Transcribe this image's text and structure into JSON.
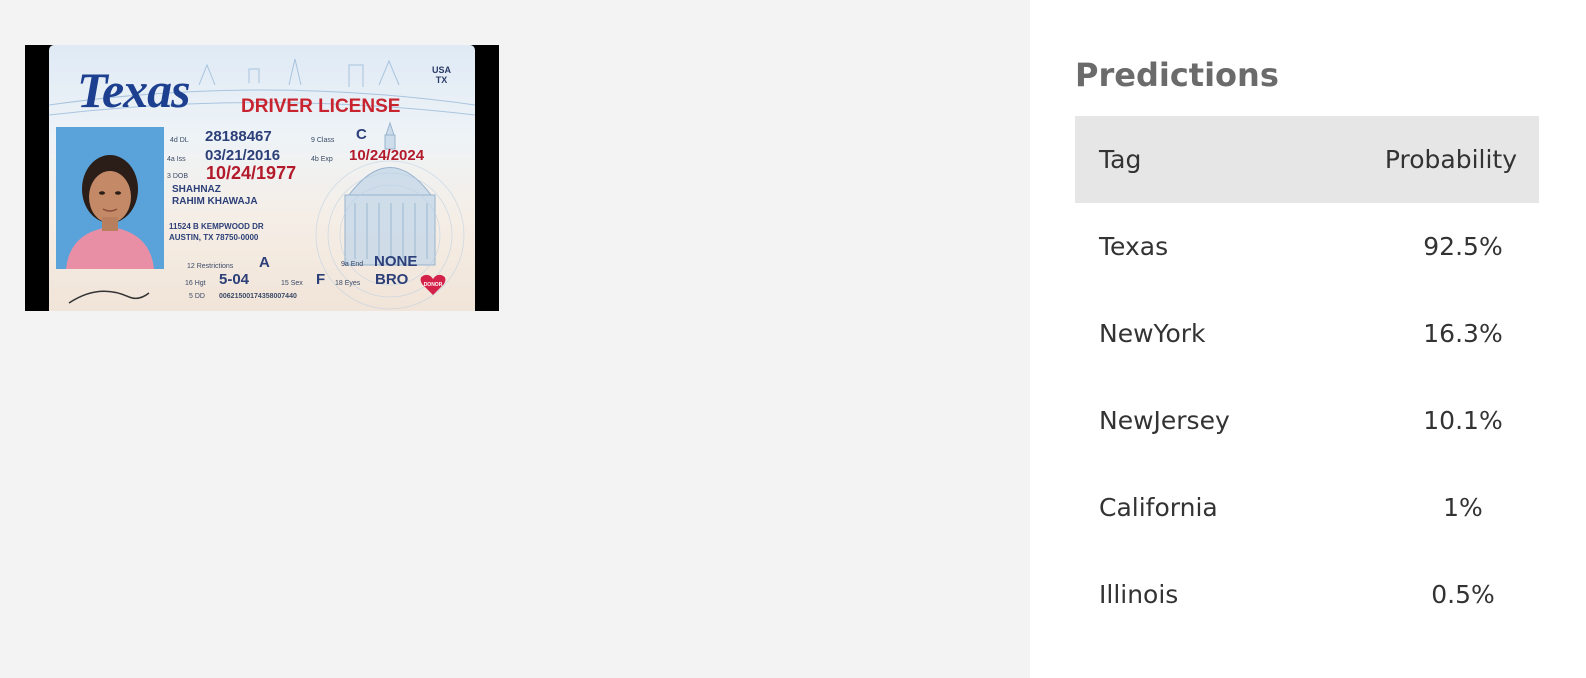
{
  "license": {
    "state": "Texas",
    "title": "DRIVER LICENSE",
    "country": "USA",
    "country_code": "TX",
    "dl_label": "4d DL",
    "dl_number": "28188467",
    "class_label": "9 Class",
    "class_value": "C",
    "iss_label": "4a Iss",
    "iss_date": "03/21/2016",
    "exp_label": "4b Exp",
    "exp_date": "10/24/2024",
    "dob_label": "3 DOB",
    "dob": "10/24/1977",
    "name_first": "SHAHNAZ",
    "name_last": "RAHIM KHAWAJA",
    "address_line1": "11524 B KEMPWOOD DR",
    "address_line2": "AUSTIN, TX 78750-0000",
    "restrictions_label": "12 Restrictions",
    "restrictions_value": "A",
    "end_label": "9a End",
    "end_value": "NONE",
    "hgt_label": "16 Hgt",
    "hgt_value": "5-04",
    "sex_label": "15 Sex",
    "sex_value": "F",
    "eyes_label": "18 Eyes",
    "eyes_value": "BRO",
    "dd_label": "5 DD",
    "dd_value": "00621500174358007440",
    "donor": "DONOR",
    "photo_icon": "portrait-photo",
    "accent_blue": "#1d3f8f",
    "accent_red": "#c8242f"
  },
  "predictions": {
    "title": "Predictions",
    "columns": {
      "tag": "Tag",
      "probability": "Probability"
    },
    "rows": [
      {
        "tag": "Texas",
        "probability": "92.5%"
      },
      {
        "tag": "NewYork",
        "probability": "16.3%"
      },
      {
        "tag": "NewJersey",
        "probability": "10.1%"
      },
      {
        "tag": "California",
        "probability": "1%"
      },
      {
        "tag": "Illinois",
        "probability": "0.5%"
      }
    ]
  }
}
